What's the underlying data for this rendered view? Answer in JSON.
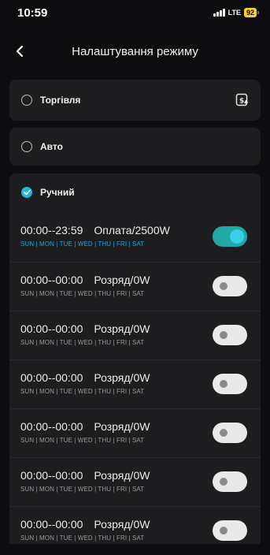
{
  "status_bar": {
    "time": "10:59",
    "network": "LTE",
    "battery": "92"
  },
  "nav": {
    "title": "Налаштування режиму"
  },
  "modes": [
    {
      "label": "Торгівля",
      "selected": false
    },
    {
      "label": "Авто",
      "selected": false
    },
    {
      "label": "Ручний",
      "selected": true
    }
  ],
  "days_text": "SUN | MON | TUE | WED | THU | FRI | SAT",
  "schedules": [
    {
      "time": "00:00--23:59",
      "mode": "Оплата/2500W",
      "enabled": true
    },
    {
      "time": "00:00--00:00",
      "mode": "Розряд/0W",
      "enabled": false
    },
    {
      "time": "00:00--00:00",
      "mode": "Розряд/0W",
      "enabled": false
    },
    {
      "time": "00:00--00:00",
      "mode": "Розряд/0W",
      "enabled": false
    },
    {
      "time": "00:00--00:00",
      "mode": "Розряд/0W",
      "enabled": false
    },
    {
      "time": "00:00--00:00",
      "mode": "Розряд/0W",
      "enabled": false
    },
    {
      "time": "00:00--00:00",
      "mode": "Розряд/0W",
      "enabled": false
    }
  ],
  "colors": {
    "accent": "#2ab4dc",
    "toggle_on": "#23a8a8",
    "card": "#1d1d1f",
    "background": "#0d0d0f"
  }
}
